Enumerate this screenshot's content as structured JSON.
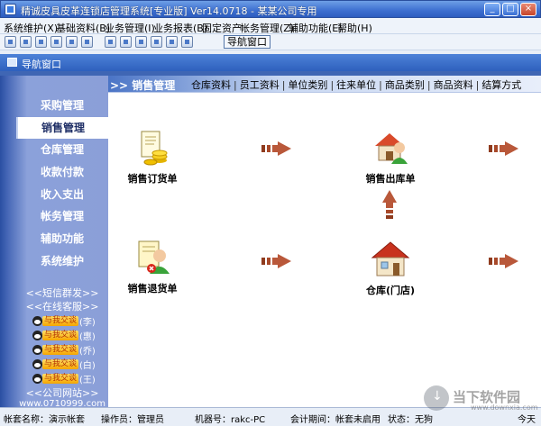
{
  "window": {
    "title": "精诚皮具皮革连锁店管理系统[专业版] Ver14.0718 - 某某公司专用",
    "min_glyph": "_",
    "max_glyph": "□",
    "close_glyph": "×"
  },
  "menu": [
    "系统维护(X)",
    "基础资料(B)",
    "业务管理(I)",
    "业务报表(B)",
    "固定资产",
    "帐务管理(Z)",
    "辅助功能(E)",
    "帮助(H)"
  ],
  "toolbar": {
    "icons": [
      "new-icon",
      "list-icon",
      "window-icon",
      "copy-icon",
      "edit-icon",
      "user-icon",
      "users-icon",
      "table-icon",
      "save-icon",
      "print-icon",
      "help-icon",
      "exit-icon"
    ],
    "nav_window_label": "导航窗口"
  },
  "nav_panel": {
    "title": "导航窗口"
  },
  "sidebar": {
    "items": [
      "采购管理",
      "销售管理",
      "仓库管理",
      "收款付款",
      "收入支出",
      "帐务管理",
      "辅助功能",
      "系统维护"
    ],
    "active_index": 1,
    "sms_link": "<<短信群发>>",
    "support_link": "<<在线客服>>",
    "qq_badge": "与我交谈",
    "qq_contacts": [
      "(李)",
      "(惠)",
      "(乔)",
      "(白)",
      "(王)"
    ],
    "company_link": "<<公司网站>>",
    "company_url_partial": "www.0710999.com"
  },
  "main": {
    "active_tab": ">> 销售管理",
    "tab_links": [
      "仓库资料",
      "员工资料",
      "单位类别",
      "往来单位",
      "商品类别",
      "商品资料",
      "结算方式"
    ],
    "nodes": {
      "sales_order": "销售订货单",
      "sales_outbound": "销售出库单",
      "sales_return": "销售退货单",
      "warehouse": "仓库(门店)"
    }
  },
  "status": {
    "account": "帐套名称：演示帐套",
    "operator": "操作员：管理员",
    "machine": "机器号：rakc-PC",
    "period": "会计期间：帐套未启用",
    "state": "状态：无狗",
    "day": "今天"
  },
  "watermark": {
    "text": "当下软件园",
    "sub": "www.downxia.com"
  }
}
